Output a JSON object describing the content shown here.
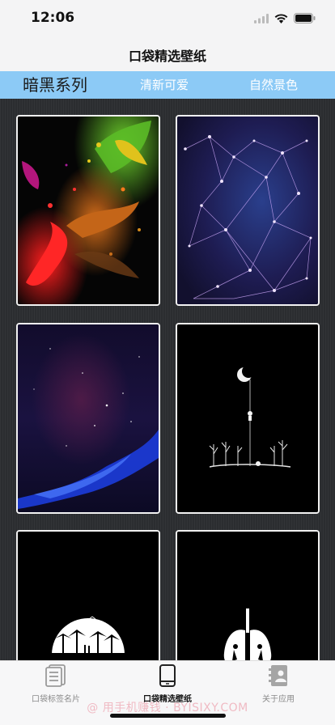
{
  "status": {
    "time": "12:06"
  },
  "nav": {
    "title": "口袋精选壁纸"
  },
  "categories": [
    {
      "label": "暗黑系列",
      "active": true
    },
    {
      "label": "清新可爱",
      "active": false
    },
    {
      "label": "自然景色",
      "active": false
    }
  ],
  "wallpapers": [
    {
      "name": "colorful-paint-splash-wallpaper"
    },
    {
      "name": "purple-network-nodes-wallpaper"
    },
    {
      "name": "night-sky-nebula-wallpaper"
    },
    {
      "name": "moon-climber-wallpaper"
    },
    {
      "name": "palm-island-silhouette-wallpaper"
    },
    {
      "name": "lungs-silhouette-wallpaper"
    }
  ],
  "tabbar": {
    "items": [
      {
        "label": "口袋标签名片",
        "icon": "document-list-icon",
        "active": false
      },
      {
        "label": "口袋精选壁纸",
        "icon": "phone-icon",
        "active": true
      },
      {
        "label": "关于应用",
        "icon": "contact-book-icon",
        "active": false
      }
    ]
  },
  "watermark": "@ 用手机赚钱 · BYISIXY.COM"
}
